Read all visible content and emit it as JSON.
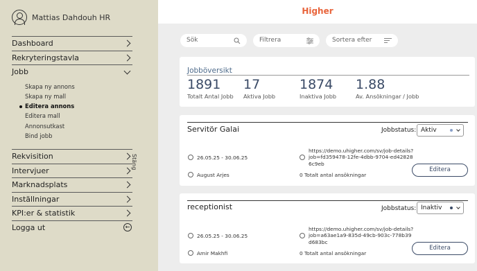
{
  "user": {
    "name": "Mattias Dahdouh HR"
  },
  "sidebar": {
    "items_top": [
      {
        "label": "Dashboard"
      },
      {
        "label": "Rekryteringstavla"
      }
    ],
    "jobb": {
      "label": "Jobb",
      "sub_items": [
        "Skapa ny annons",
        "Skapa ny mall",
        "Editera annons",
        "Editera mall",
        "Annonsutkast",
        "Bind jobb"
      ],
      "active_sub": "Editera annons"
    },
    "items_bottom": [
      {
        "label": "Rekvisition"
      },
      {
        "label": "Intervjuer"
      },
      {
        "label": "Marknadsplats"
      },
      {
        "label": "Inställningar"
      },
      {
        "label": "KPI:er & statistik"
      }
    ],
    "logout": "Logga ut",
    "close": "Stäng"
  },
  "header": {
    "logo": "Higher",
    "logo_color": "#e8643b"
  },
  "filters": {
    "search_placeholder": "Sök",
    "filter_label": "Filtrera",
    "sort_label": "Sortera efter"
  },
  "overview": {
    "title": "Jobböversikt",
    "stats": [
      {
        "value": "1891",
        "label": "Totalt Antal Jobb"
      },
      {
        "value": "17",
        "label": "Aktiva Jobb"
      },
      {
        "value": "1874",
        "label": "Inaktiva Jobb"
      },
      {
        "value": "1.88",
        "label": "Av. Ansökningar / Jobb"
      }
    ]
  },
  "jobs": [
    {
      "title": "Servitör Galai",
      "status_label": "Jobbstatus:",
      "status": "Aktiv",
      "status_color": "#8aa0c8",
      "dates": "26.05.25 - 30.06.25",
      "url": "https://demo.uhigher.com/sv/job-details?job=fd359478-12fe-4dbb-9704-ed428286c9eb",
      "owner": "August Arjes",
      "applications": "0 Totalt antal ansökningar",
      "edit": "Editera"
    },
    {
      "title": "receptionist",
      "status_label": "Jobbstatus:",
      "status": "Inaktiv",
      "status_color": "#3a4a66",
      "dates": "26.05.25 - 30.06.25",
      "url": "https://demo.uhigher.com/sv/job-details?job=a63ae1a9-835d-49cb-903c-778b39d683bc",
      "owner": "Amir Makhfi",
      "applications": "0 Totalt antal ansökningar",
      "edit": "Editera"
    }
  ]
}
